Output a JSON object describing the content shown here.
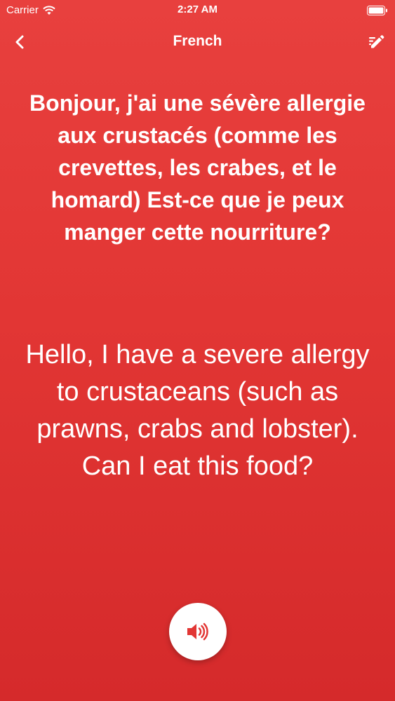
{
  "status_bar": {
    "carrier": "Carrier",
    "time": "2:27 AM"
  },
  "nav": {
    "title": "French",
    "back_icon": "chevron-left-icon",
    "edit_icon": "pencil-edit-icon"
  },
  "phrase": {
    "original": "Bonjour, j'ai une sévère allergie aux crustacés (comme les crevettes, les crabes, et le homard) Est-ce que je peux manger cette nourriture?",
    "translation": "Hello, I have a severe allergy to crustaceans (such as prawns, crabs and lobster). Can I eat this food?"
  },
  "actions": {
    "speak_icon": "speaker-icon"
  },
  "colors": {
    "background": "#e23634",
    "accent": "#e23634",
    "text": "#ffffff"
  }
}
